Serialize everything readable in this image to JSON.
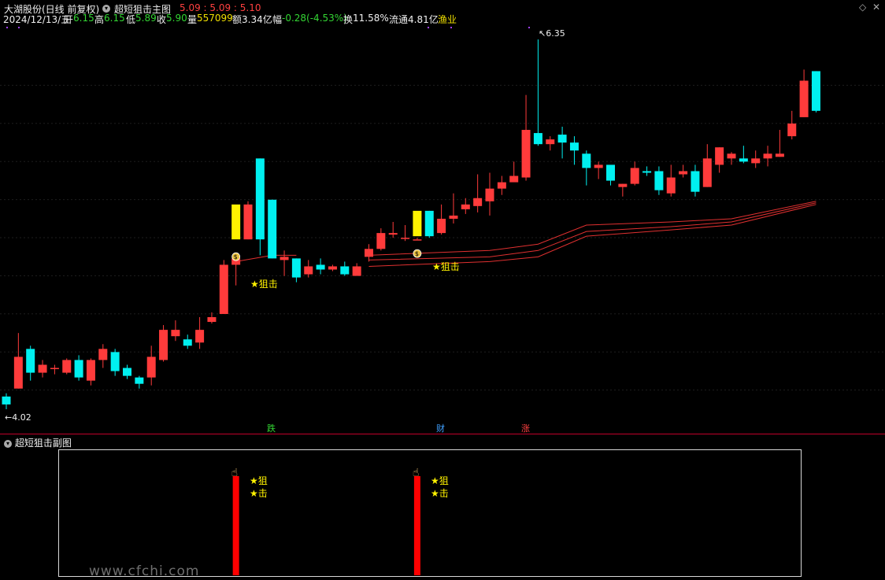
{
  "header": {
    "stock_name": "大湖股份(日线 前复权)",
    "indicator_name": "超短狙击主图",
    "indicator_values": "5.09 : 5.09 : 5.10"
  },
  "quote": {
    "date": "2024/12/13/五",
    "open_label": "开",
    "open": "6.15",
    "high_label": "高",
    "high": "6.15",
    "low_label": "低",
    "low": "5.89",
    "close_label": "收",
    "close": "5.90",
    "volume_label": "量",
    "volume": "557099",
    "amount_label": "额",
    "amount": "3.34亿",
    "change_label": "幅",
    "change": "-0.28(-4.53%)",
    "turnover_label": "换",
    "turnover": "11.58%",
    "float_label": "流通",
    "float": "4.81亿",
    "sector": "渔业"
  },
  "price_labels": {
    "max": "6.35",
    "min": "4.02"
  },
  "signals": {
    "main": "狙击",
    "sub_top": "狙",
    "sub_bottom": "击"
  },
  "bottom_tags": {
    "fall": "跌",
    "wealth": "财",
    "rise": "涨"
  },
  "sub_panel": {
    "title": "超短狙击副图"
  },
  "watermark": "www.cfchi.com",
  "colors": {
    "up": "#ff3b3b",
    "down": "#00f0f0",
    "signal": "#fff200",
    "ma": "#e03030",
    "bar": "#ff0000"
  },
  "chart_data": {
    "type": "candlestick",
    "ylim": [
      4.0,
      6.4
    ],
    "candles": [
      [
        4.1,
        4.05,
        4.12,
        4.02
      ],
      [
        4.15,
        4.35,
        4.5,
        4.15
      ],
      [
        4.4,
        4.25,
        4.42,
        4.2
      ],
      [
        4.25,
        4.3,
        4.33,
        4.22
      ],
      [
        4.28,
        4.28,
        4.3,
        4.24
      ],
      [
        4.25,
        4.33,
        4.34,
        4.24
      ],
      [
        4.33,
        4.22,
        4.36,
        4.2
      ],
      [
        4.2,
        4.33,
        4.34,
        4.17
      ],
      [
        4.33,
        4.4,
        4.43,
        4.28
      ],
      [
        4.38,
        4.26,
        4.4,
        4.23
      ],
      [
        4.28,
        4.23,
        4.3,
        4.21
      ],
      [
        4.22,
        4.18,
        4.23,
        4.15
      ],
      [
        4.22,
        4.35,
        4.42,
        4.17
      ],
      [
        4.33,
        4.52,
        4.55,
        4.32
      ],
      [
        4.48,
        4.52,
        4.58,
        4.45
      ],
      [
        4.46,
        4.42,
        4.49,
        4.4
      ],
      [
        4.44,
        4.52,
        4.6,
        4.4
      ],
      [
        4.57,
        4.6,
        4.63,
        4.56
      ],
      [
        4.62,
        4.93,
        4.96,
        4.62
      ],
      [
        4.93,
        4.97,
        5.0,
        4.8
      ],
      [
        5.09,
        5.31,
        5.33,
        5.09
      ],
      [
        5.6,
        5.09,
        5.6,
        4.99
      ],
      [
        5.34,
        4.97,
        5.34,
        4.97
      ],
      [
        4.96,
        4.98,
        5.02,
        4.86
      ],
      [
        4.97,
        4.85,
        4.97,
        4.82
      ],
      [
        4.87,
        4.92,
        4.96,
        4.85
      ],
      [
        4.93,
        4.9,
        4.97,
        4.87
      ],
      [
        4.9,
        4.92,
        4.93,
        4.89
      ],
      [
        4.92,
        4.87,
        4.95,
        4.86
      ],
      [
        4.86,
        4.92,
        4.94,
        4.86
      ],
      [
        4.98,
        5.03,
        5.06,
        4.95
      ],
      [
        5.03,
        5.13,
        5.16,
        5.02
      ],
      [
        5.12,
        5.13,
        5.2,
        5.1
      ],
      [
        5.1,
        5.1,
        5.18,
        5.08
      ],
      [
        5.09,
        5.09,
        5.1,
        5.09
      ],
      [
        5.27,
        5.11,
        5.27,
        5.1
      ],
      [
        5.13,
        5.22,
        5.31,
        5.12
      ],
      [
        5.22,
        5.24,
        5.38,
        5.19
      ],
      [
        5.28,
        5.31,
        5.35,
        5.25
      ],
      [
        5.3,
        5.35,
        5.5,
        5.26
      ],
      [
        5.33,
        5.41,
        5.51,
        5.24
      ],
      [
        5.41,
        5.45,
        5.49,
        5.37
      ],
      [
        5.45,
        5.49,
        5.58,
        5.46
      ],
      [
        5.48,
        5.78,
        6.0,
        5.46
      ],
      [
        5.76,
        5.69,
        6.35,
        5.68
      ],
      [
        5.69,
        5.72,
        5.74,
        5.65
      ],
      [
        5.75,
        5.7,
        5.8,
        5.6
      ],
      [
        5.7,
        5.65,
        5.74,
        5.56
      ],
      [
        5.63,
        5.54,
        5.65,
        5.43
      ],
      [
        5.54,
        5.56,
        5.58,
        5.47
      ],
      [
        5.56,
        5.46,
        5.55,
        5.43
      ],
      [
        5.42,
        5.44,
        5.44,
        5.36
      ],
      [
        5.44,
        5.54,
        5.58,
        5.43
      ],
      [
        5.52,
        5.51,
        5.55,
        5.49
      ],
      [
        5.52,
        5.4,
        5.55,
        5.37
      ],
      [
        5.38,
        5.48,
        5.56,
        5.36
      ],
      [
        5.5,
        5.52,
        5.56,
        5.48
      ],
      [
        5.52,
        5.39,
        5.56,
        5.36
      ],
      [
        5.42,
        5.6,
        5.69,
        5.42
      ],
      [
        5.56,
        5.67,
        5.67,
        5.51
      ],
      [
        5.6,
        5.63,
        5.64,
        5.56
      ],
      [
        5.6,
        5.58,
        5.68,
        5.57
      ],
      [
        5.57,
        5.6,
        5.65,
        5.54
      ],
      [
        5.6,
        5.63,
        5.68,
        5.55
      ],
      [
        5.61,
        5.63,
        5.78,
        5.61
      ],
      [
        5.74,
        5.82,
        5.9,
        5.72
      ],
      [
        5.86,
        6.09,
        6.16,
        5.86
      ],
      [
        6.15,
        5.9,
        6.15,
        5.89
      ]
    ],
    "ma_series": [
      {
        "points": [
          [
            19,
            4.95
          ],
          [
            22,
            4.99
          ],
          [
            24,
            4.99
          ]
        ]
      },
      {
        "points": [
          [
            30,
            4.99
          ],
          [
            40,
            5.02
          ],
          [
            44,
            5.06
          ],
          [
            48,
            5.18
          ],
          [
            55,
            5.2
          ],
          [
            60,
            5.22
          ],
          [
            67,
            5.33
          ]
        ]
      },
      {
        "points": [
          [
            30,
            4.96
          ],
          [
            40,
            4.98
          ],
          [
            44,
            5.02
          ],
          [
            48,
            5.14
          ],
          [
            55,
            5.17
          ],
          [
            60,
            5.2
          ],
          [
            67,
            5.32
          ]
        ]
      },
      {
        "points": [
          [
            30,
            4.92
          ],
          [
            40,
            4.95
          ],
          [
            44,
            4.98
          ],
          [
            48,
            5.11
          ],
          [
            55,
            5.15
          ],
          [
            60,
            5.18
          ],
          [
            67,
            5.31
          ]
        ]
      }
    ],
    "signal_days": [
      19,
      34
    ],
    "yellow_candles": [
      [
        19,
        5.09,
        5.31
      ],
      [
        34,
        5.11,
        5.27
      ]
    ]
  }
}
